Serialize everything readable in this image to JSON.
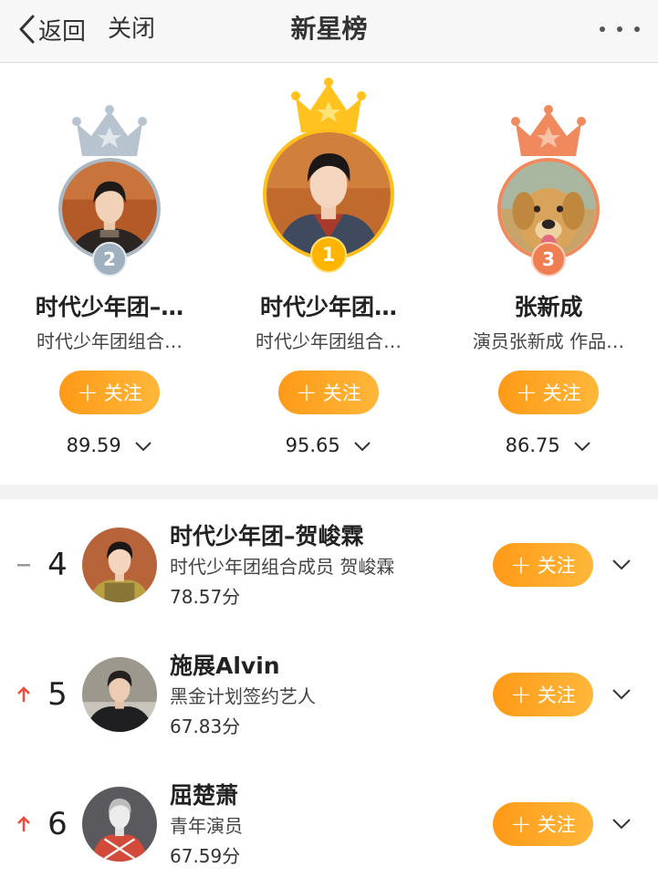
{
  "nav": {
    "back_label": "返回",
    "close_label": "关闭",
    "title": "新星榜",
    "more_icon": "more-icon"
  },
  "theme": {
    "accent": "#ff9f1c",
    "gold": "#ffbe1a",
    "silver": "#aab8c4",
    "bronze": "#f08a5e",
    "trend_up": "#f04a3a"
  },
  "podium": [
    {
      "rank": "2",
      "name": "时代少年团–…",
      "desc": "时代少年团组合…",
      "follow_label": "关注",
      "score": "89.59"
    },
    {
      "rank": "1",
      "name": "时代少年团…",
      "desc": "时代少年团组合…",
      "follow_label": "关注",
      "score": "95.65"
    },
    {
      "rank": "3",
      "name": "张新成",
      "desc": "演员张新成 作品…",
      "follow_label": "关注",
      "score": "86.75"
    }
  ],
  "list": [
    {
      "rank": "4",
      "trend": "same",
      "name": "时代少年团–贺峻霖",
      "desc": "时代少年团组合成员 贺峻霖",
      "score": "78.57分",
      "follow_label": "关注"
    },
    {
      "rank": "5",
      "trend": "up",
      "name": "施展Alvin",
      "desc": "黑金计划签约艺人",
      "score": "67.83分",
      "follow_label": "关注"
    },
    {
      "rank": "6",
      "trend": "up",
      "name": "屈楚萧",
      "desc": "青年演员",
      "score": "67.59分",
      "follow_label": "关注"
    }
  ]
}
